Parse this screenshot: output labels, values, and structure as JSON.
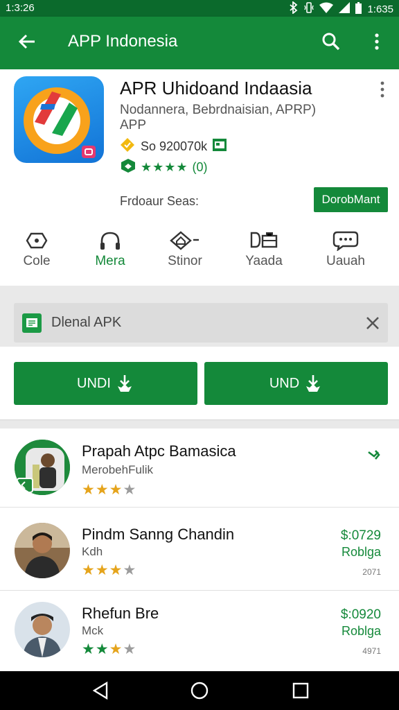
{
  "status_bar": {
    "time": "1:3:26",
    "clock_right": "1:635",
    "icons": [
      "bluetooth-icon",
      "vibrate-icon",
      "wifi-icon",
      "signal-icon",
      "battery-icon"
    ]
  },
  "app_bar": {
    "title": "APP Indonesia",
    "icons": [
      "back-arrow-icon",
      "search-icon",
      "more-vert-icon"
    ],
    "color": "#14893a"
  },
  "app_card": {
    "title": "APR Uhidoand Indaasia",
    "developer": "Nodannera, Bebrdnaisian, APRP)",
    "category": "APP",
    "size_text": "So 920070k",
    "rating_value": "(0)",
    "rating_stars": "★★★★",
    "features_label": "Frdoaur Seas:",
    "download_label": "DorobMant"
  },
  "categories": [
    {
      "label": "Cole",
      "icon": "tag-icon",
      "active": false
    },
    {
      "label": "Mera",
      "icon": "headphones-icon",
      "active": true
    },
    {
      "label": "Stinor",
      "icon": "home-diamond-icon",
      "active": false
    },
    {
      "label": "Yaada",
      "icon": "briefcase-icon",
      "active": false
    },
    {
      "label": "Uauah",
      "icon": "chat-bubble-icon",
      "active": false
    }
  ],
  "notice": {
    "text": "Dlenal APK",
    "close_icon": "close-icon"
  },
  "buttons": [
    {
      "label": "UNDI"
    },
    {
      "label": "UND"
    }
  ],
  "list": [
    {
      "name": "Prapah Atpc Bamasica",
      "sub": "MerobehFulik",
      "stars": "★★",
      "half_star": "★",
      "empty_star": "★",
      "right_icon": "arrow-right-icon",
      "price": "",
      "tag": "",
      "count": ""
    },
    {
      "name": "Pindm Sanng Chandin",
      "sub": "Kdh",
      "stars": "★★",
      "half_star": "★",
      "empty_star": "★",
      "price": "$:0729",
      "tag": "Roblga",
      "count": "2071"
    },
    {
      "name": "Rhefun Bre",
      "sub": "Mck",
      "stars": "★★",
      "half_star": "★",
      "empty_star": "★",
      "price": "$:0920",
      "tag": "Roblga",
      "count": "4971"
    }
  ],
  "nav_bar": {
    "icons": [
      "back-triangle-icon",
      "home-circle-icon",
      "recents-square-icon"
    ]
  }
}
